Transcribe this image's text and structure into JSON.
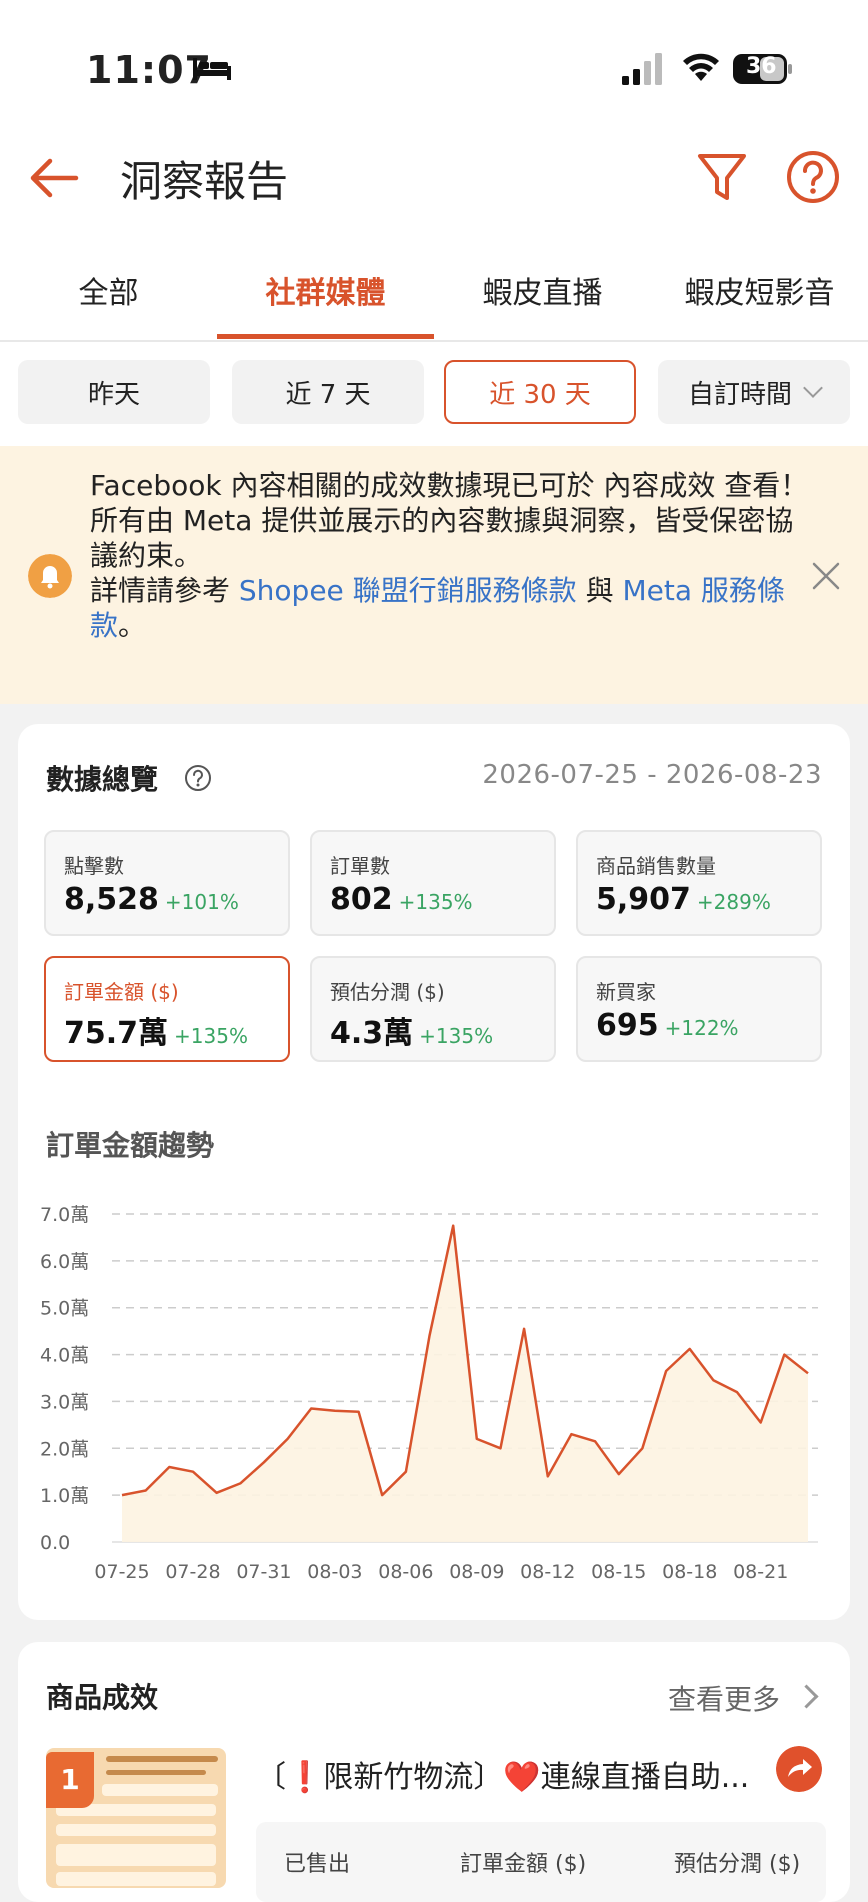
{
  "status_bar": {
    "time": "11:07",
    "battery": "36"
  },
  "header": {
    "title": "洞察報告"
  },
  "tabs": [
    {
      "label": "全部"
    },
    {
      "label": "社群媒體"
    },
    {
      "label": "蝦皮直播"
    },
    {
      "label": "蝦皮短影音"
    }
  ],
  "active_tab": "社群媒體",
  "date_filters": [
    {
      "label": "昨天"
    },
    {
      "label": "近 7 天"
    },
    {
      "label": "近 30 天"
    },
    {
      "label": "自訂時間"
    }
  ],
  "active_date_filter": "近 30 天",
  "notice": {
    "line1": "Facebook 內容相關的成效數據現已可於 內容成效 查看！",
    "line2": "所有由 Meta 提供並展示的內容數據與洞察，皆受保密協議約束。",
    "line3_prefix": "詳情請參考 ",
    "link1": "Shopee 聯盟行銷服務條款",
    "line3_mid": " 與 ",
    "link2": "Meta 服務條款",
    "line3_suffix": "。"
  },
  "overview": {
    "title": "數據總覽",
    "date_range": "2026-07-25 - 2026-08-23",
    "metrics": [
      {
        "label": "點擊數",
        "value": "8,528",
        "delta": "+101%"
      },
      {
        "label": "訂單數",
        "value": "802",
        "delta": "+135%"
      },
      {
        "label": "商品銷售數量",
        "value": "5,907",
        "delta": "+289%"
      },
      {
        "label": "訂單金額 ($)",
        "value": "75.7萬",
        "delta": "+135%"
      },
      {
        "label": "預估分潤 ($)",
        "value": "4.3萬",
        "delta": "+135%"
      },
      {
        "label": "新買家",
        "value": "695",
        "delta": "+122%"
      }
    ],
    "chart_title": "訂單金額趨勢"
  },
  "chart_data": {
    "type": "area",
    "title": "訂單金額趨勢",
    "xlabel": "",
    "ylabel": "",
    "x_ticks": [
      "07-25",
      "07-28",
      "07-31",
      "08-03",
      "08-06",
      "08-09",
      "08-12",
      "08-15",
      "08-18",
      "08-21"
    ],
    "y_ticks": [
      "0.0",
      "1.0萬",
      "2.0萬",
      "3.0萬",
      "4.0萬",
      "5.0萬",
      "6.0萬",
      "7.0萬"
    ],
    "ylim": [
      0,
      7.0
    ],
    "grid": true,
    "series": [
      {
        "values": [
          1.0,
          1.1,
          1.6,
          1.5,
          1.05,
          1.25,
          1.7,
          2.2,
          2.85,
          2.8,
          2.78,
          1.0,
          1.5,
          4.4,
          6.75,
          2.2,
          2.0,
          4.55,
          1.4,
          2.3,
          2.15,
          1.45,
          2.0,
          3.65,
          4.12,
          3.45,
          3.2,
          2.55,
          4.0,
          3.6
        ]
      }
    ],
    "line_color": "#d8532c",
    "fill_color": "#fdf3e1"
  },
  "products": {
    "title": "商品成效",
    "more_label": "查看更多",
    "items": [
      {
        "rank": "1",
        "name": "〔❗限新竹物流〕❤️連線直播自助...",
        "stat_labels": [
          "已售出",
          "訂單金額 ($)",
          "預估分潤 ($)"
        ]
      }
    ]
  }
}
